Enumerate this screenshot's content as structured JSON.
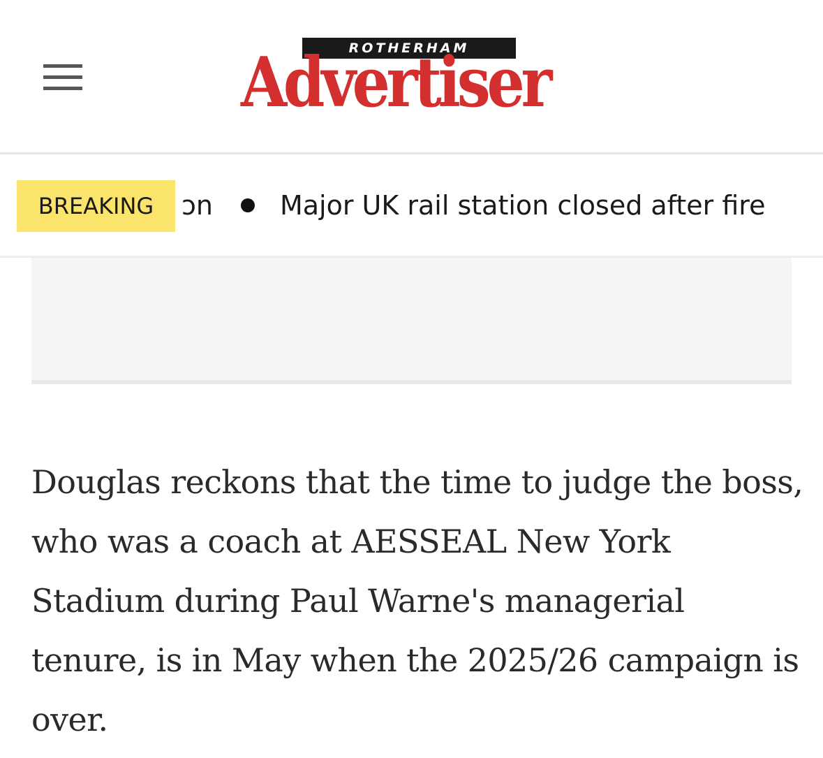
{
  "header": {
    "logo_kicker": "ROTHERHAM",
    "logo_wordmark": "Advertiser",
    "menu_icon": "hamburger-menu-icon",
    "colors": {
      "brand": "#d32f2f",
      "kicker_bg": "#1a1a1a"
    }
  },
  "breaking": {
    "label": "BREAKING",
    "label_color": "#fbe46b",
    "ticker": {
      "partial_text": "ɔn",
      "bullet_icon": "bullet-dot-icon",
      "headline": "Major UK rail station closed after fire"
    }
  },
  "article": {
    "paragraph": "Douglas reckons that the time to judge the boss, who was a coach at AESSEAL New York Stadium during Paul Warne's managerial tenure, is in May when the 2025/26 campaign is over."
  }
}
